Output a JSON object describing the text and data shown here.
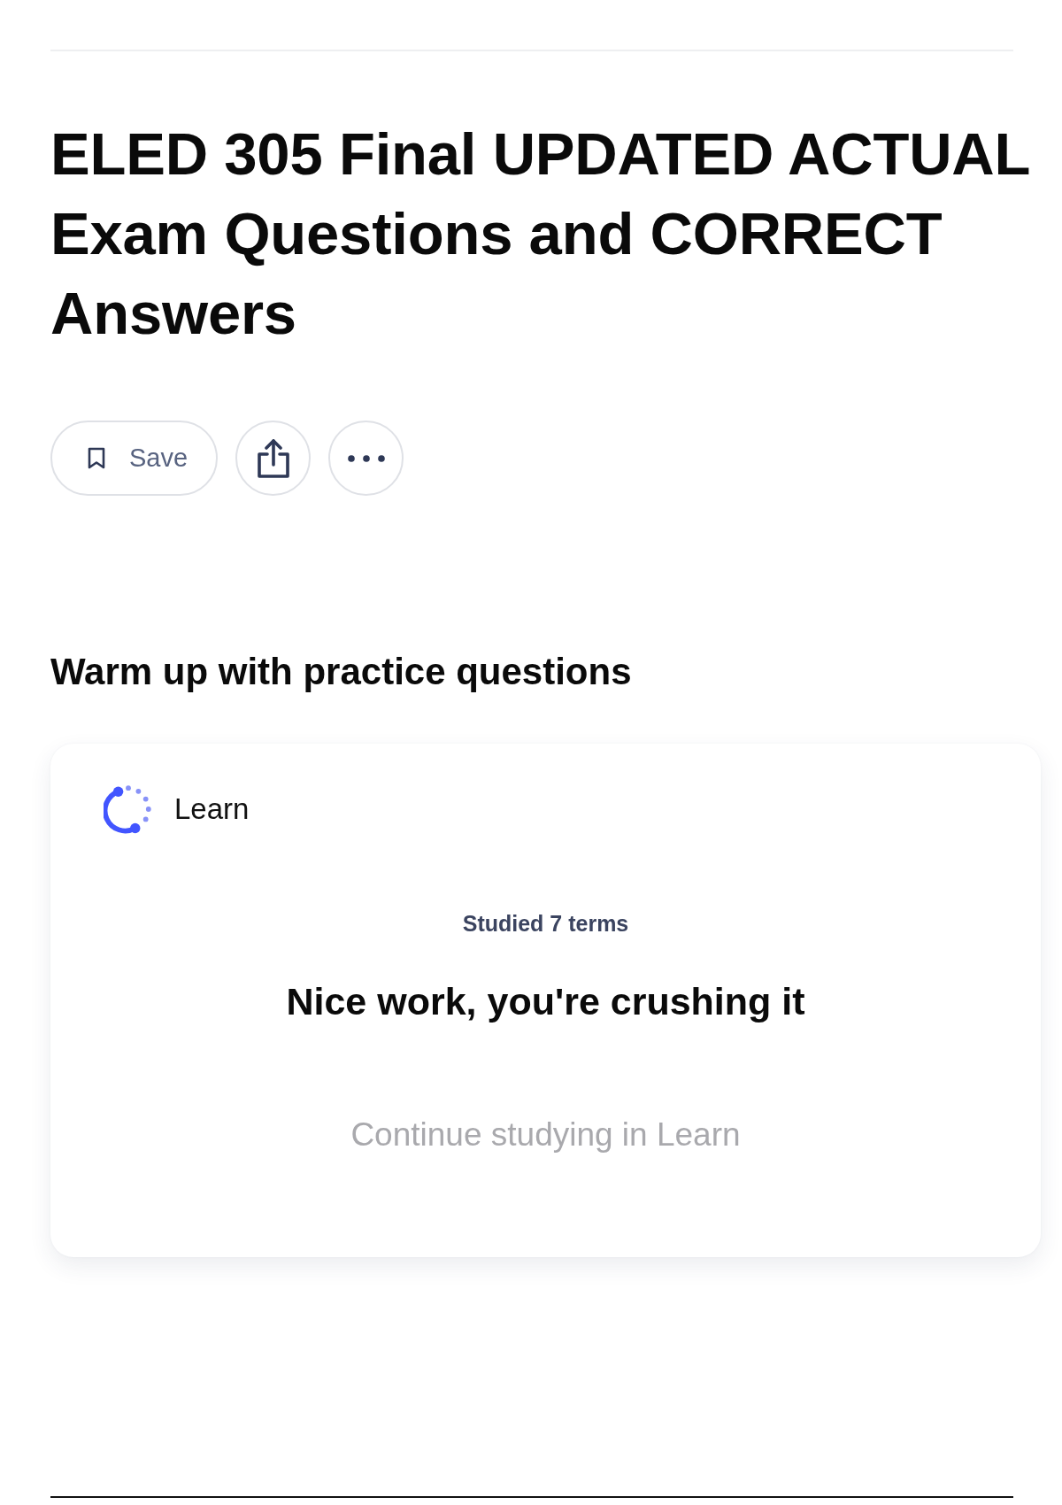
{
  "title": "ELED 305 Final UPDATED ACTUAL Exam Questions and CORRECT Answers",
  "actions": [
    {
      "kind": "save",
      "label": "Save"
    },
    {
      "kind": "share"
    },
    {
      "kind": "more"
    }
  ],
  "practice": {
    "heading": "Warm up with practice questions",
    "card": {
      "mode": "Learn",
      "progress": "Studied 7 terms",
      "message": "Nice work, you're crushing it",
      "button": "Continue studying in Learn"
    }
  }
}
